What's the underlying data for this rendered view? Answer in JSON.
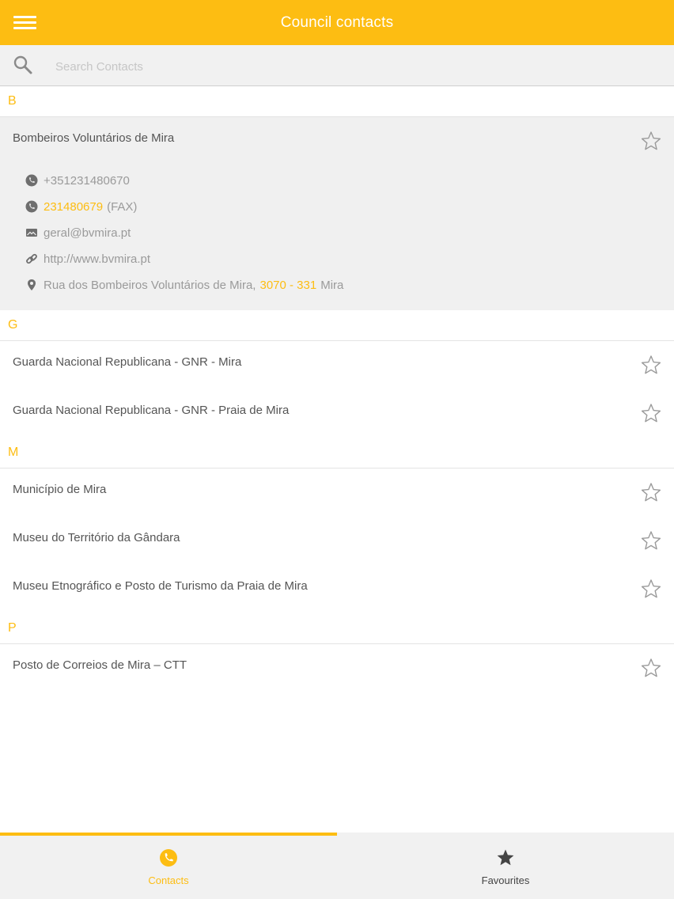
{
  "header": {
    "title": "Council contacts",
    "menu_icon": "hamburger-menu-icon"
  },
  "search": {
    "placeholder": "Search Contacts",
    "value": ""
  },
  "colors": {
    "accent": "#fdbd12",
    "text": "#555555",
    "muted": "#9a9a9a"
  },
  "sections": [
    {
      "letter": "B",
      "contacts": [
        {
          "name": "Bombeiros Voluntários de Mira",
          "expanded": true,
          "phone": "+351231480670",
          "fax_number": "231480679",
          "fax_label": "(FAX)",
          "email": "geral@bvmira.pt",
          "website": "http://www.bvmira.pt",
          "address_street": "Rua dos Bombeiros Voluntários de Mira,",
          "address_postcode": "3070 - 331",
          "address_city": "Mira"
        }
      ]
    },
    {
      "letter": "G",
      "contacts": [
        {
          "name": "Guarda Nacional Republicana - GNR - Mira"
        },
        {
          "name": "Guarda Nacional Republicana - GNR - Praia de Mira"
        }
      ]
    },
    {
      "letter": "M",
      "contacts": [
        {
          "name": "Município de Mira"
        },
        {
          "name": "Museu do Território da Gândara"
        },
        {
          "name": "Museu Etnográfico e Posto de Turismo da Praia de Mira"
        }
      ]
    },
    {
      "letter": "P",
      "contacts": [
        {
          "name": "Posto de Correios de Mira – CTT"
        }
      ]
    }
  ],
  "tabs": [
    {
      "label": "Contacts",
      "icon": "phone-icon",
      "active": true
    },
    {
      "label": "Favourites",
      "icon": "star-icon",
      "active": false
    }
  ]
}
